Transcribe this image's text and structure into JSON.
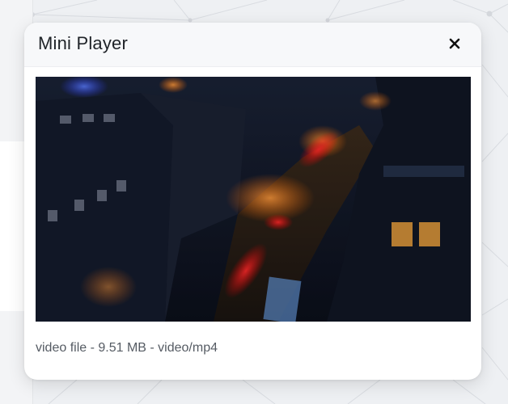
{
  "modal": {
    "title": "Mini Player",
    "close_icon": "close-icon",
    "file_info": "video file - 9.51 MB - video/mp4"
  },
  "video": {
    "kind": "video-thumbnail",
    "scene": "night-city-street-tilt-shift"
  },
  "colors": {
    "backdrop": "#eef0f3",
    "modal_bg": "#ffffff",
    "header_bg": "#f7f8fa",
    "title_text": "#1f2328",
    "info_text": "#555b63"
  }
}
